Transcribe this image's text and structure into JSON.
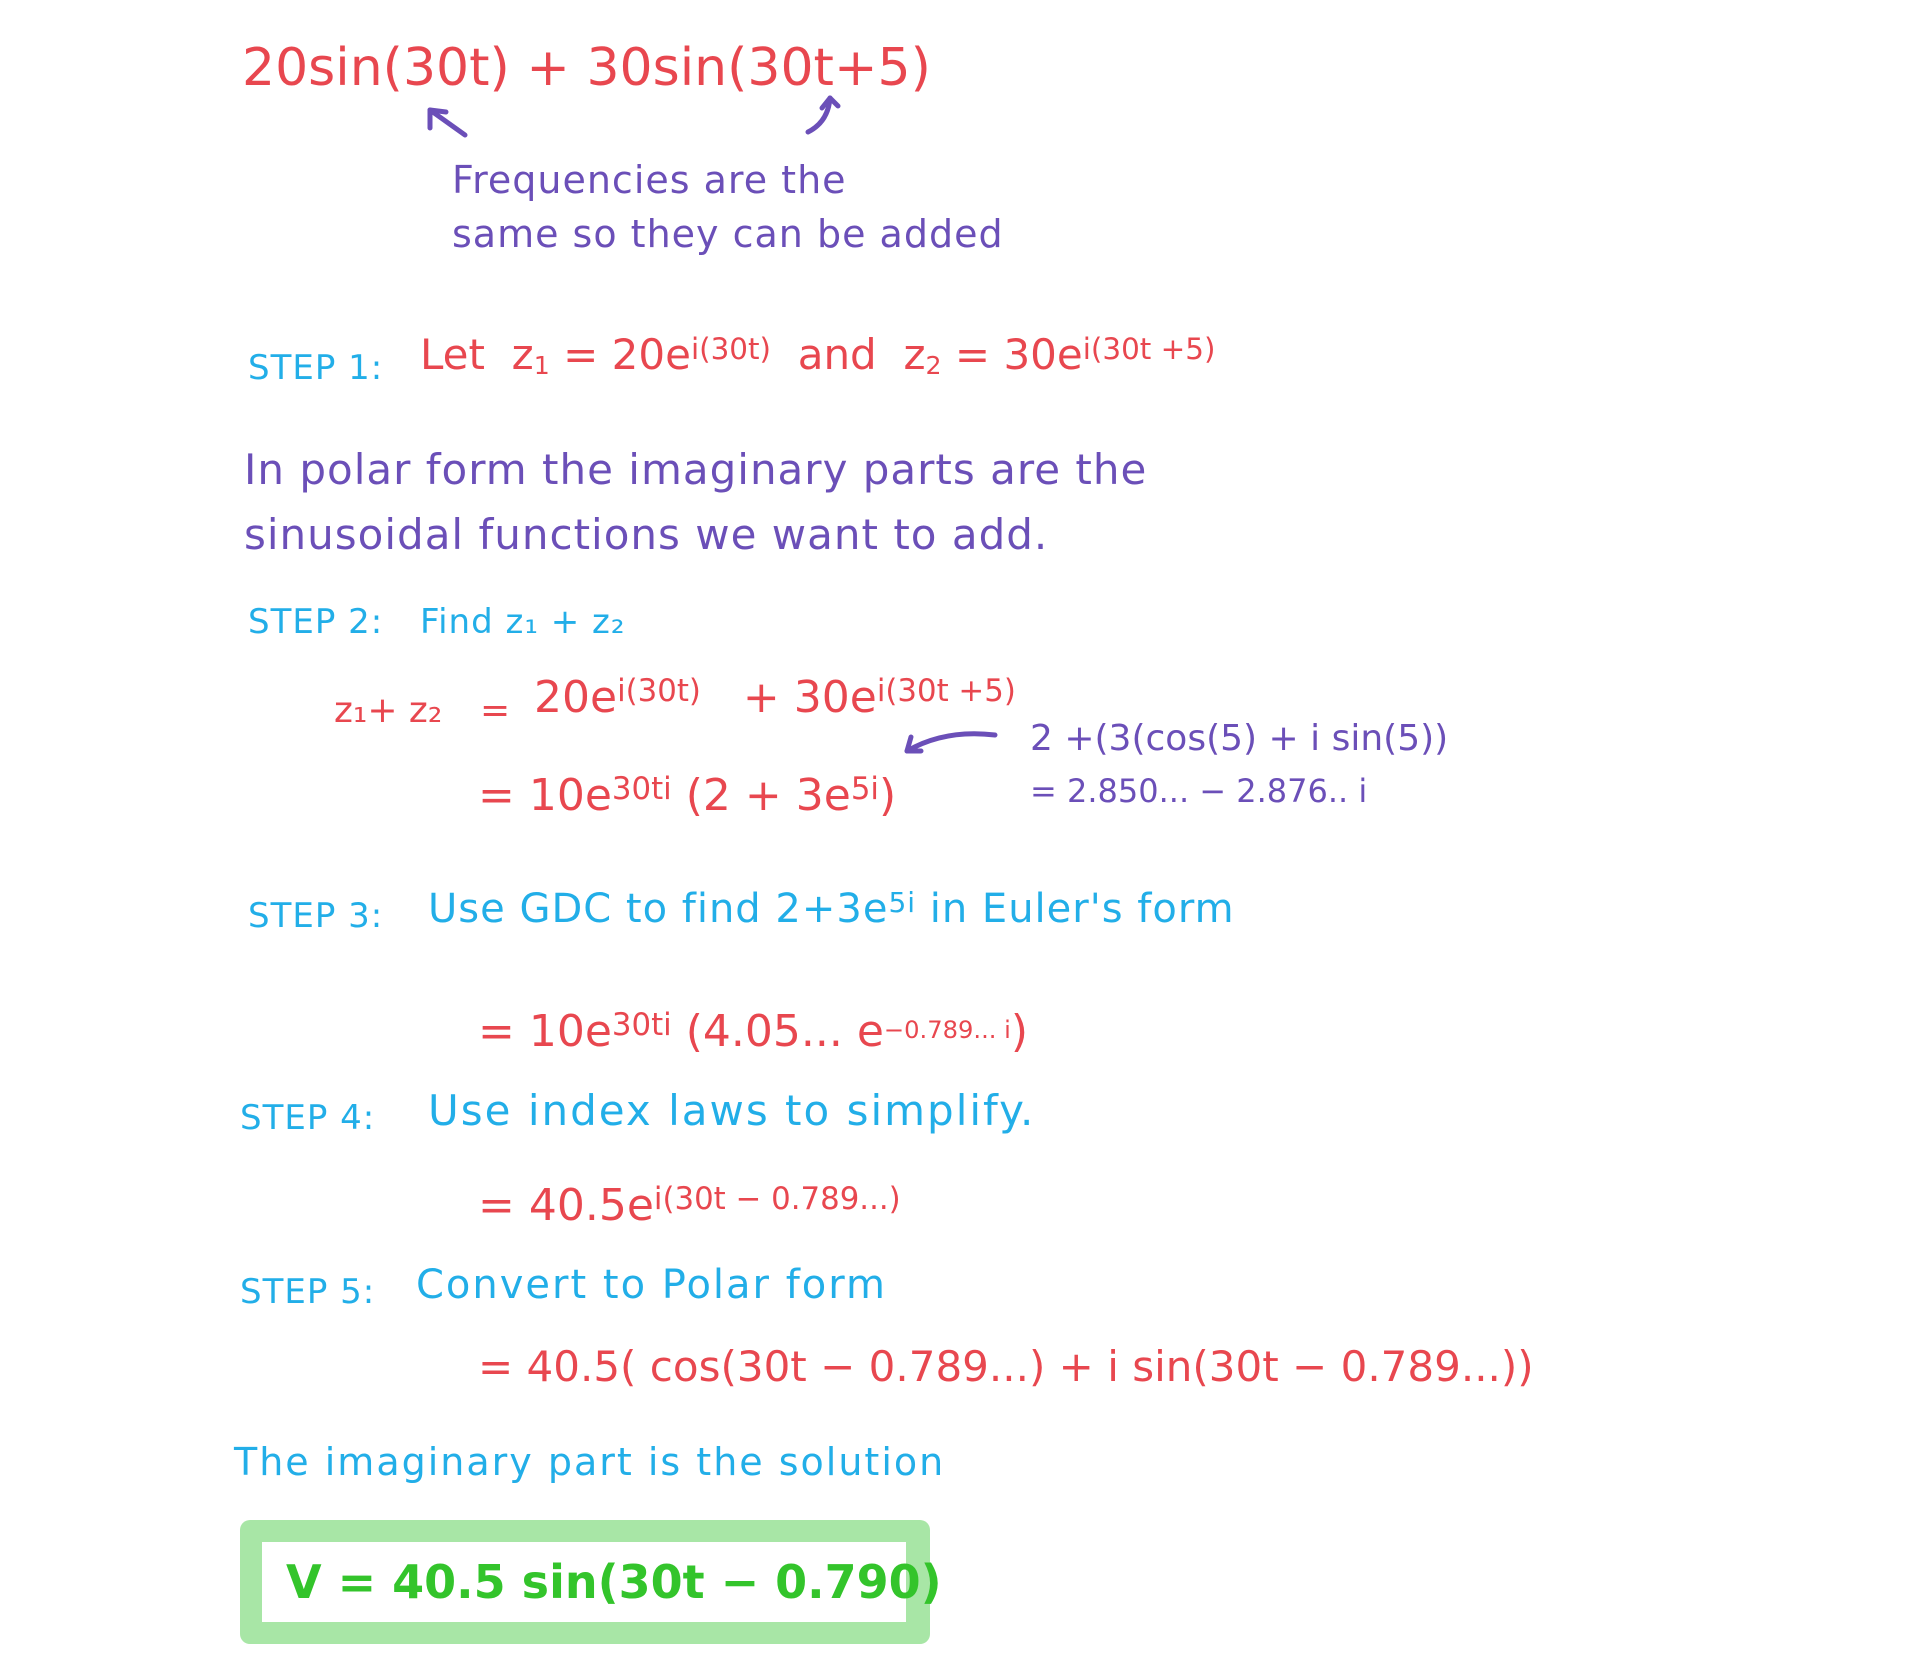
{
  "header": {
    "expression_term1": "20sin(30t)",
    "plus": "+",
    "expression_term2": "30sin(30t+5)",
    "note_line1": "Frequencies are the",
    "note_line2": "same so they can be added"
  },
  "step1": {
    "label": "STEP 1:",
    "let": "Let",
    "z1_var": "z",
    "z1_sub": "1",
    "eq": "=",
    "z1_base": "20e",
    "z1_exp": "i(30t)",
    "and": "and",
    "z2_var": "z",
    "z2_sub": "2",
    "z2_base": "30e",
    "z2_exp": "i(30t +5)"
  },
  "polar_note": {
    "line1": "In polar form the imaginary parts are the",
    "line2": "sinusoidal functions we want to add."
  },
  "step2": {
    "label": "STEP 2:",
    "instruction": "Find z₁ + z₂",
    "lhs": "z₁+ z₂",
    "eq": "=",
    "term1_base": "20e",
    "term1_exp": "i(30t)",
    "term2_base": "+ 30e",
    "term2_exp": "i(30t +5)",
    "line2_prefix": "= 10e",
    "line2_exp": "30ti",
    "line2_paren_open": "(2 + 3e",
    "line2_inner_exp": "5i",
    "line2_paren_close": ")",
    "side_note_line1": "2 +(3(cos(5) + i sin(5))",
    "side_note_line2": "= 2.850... − 2.876.. i"
  },
  "step3": {
    "label": "STEP 3:",
    "instruction_pre": "Use GDC to find 2+3e",
    "instruction_exp": "5i",
    "instruction_post": "in Euler's form",
    "result_prefix": "= 10e",
    "result_exp": "30ti",
    "result_body": "(4.05... e",
    "result_inner_exp": "−0.789... i",
    "result_close": ")"
  },
  "step4": {
    "label": "STEP 4:",
    "instruction": "Use index laws to simplify.",
    "result_prefix": "= 40.5e",
    "result_exp": "i(30t − 0.789...)"
  },
  "step5": {
    "label": "STEP 5:",
    "instruction": "Convert to Polar form",
    "result": "= 40.5( cos(30t − 0.789...) + i sin(30t − 0.789...))"
  },
  "conclusion": {
    "text": "The imaginary part is the solution",
    "answer": "V = 40.5 sin(30t − 0.790)"
  },
  "colors": {
    "math_red": "#E8474F",
    "step_blue": "#22AEE8",
    "note_purple": "#6B4FB8",
    "answer_green": "#33C42B",
    "answer_border": "#A8E6A6"
  }
}
